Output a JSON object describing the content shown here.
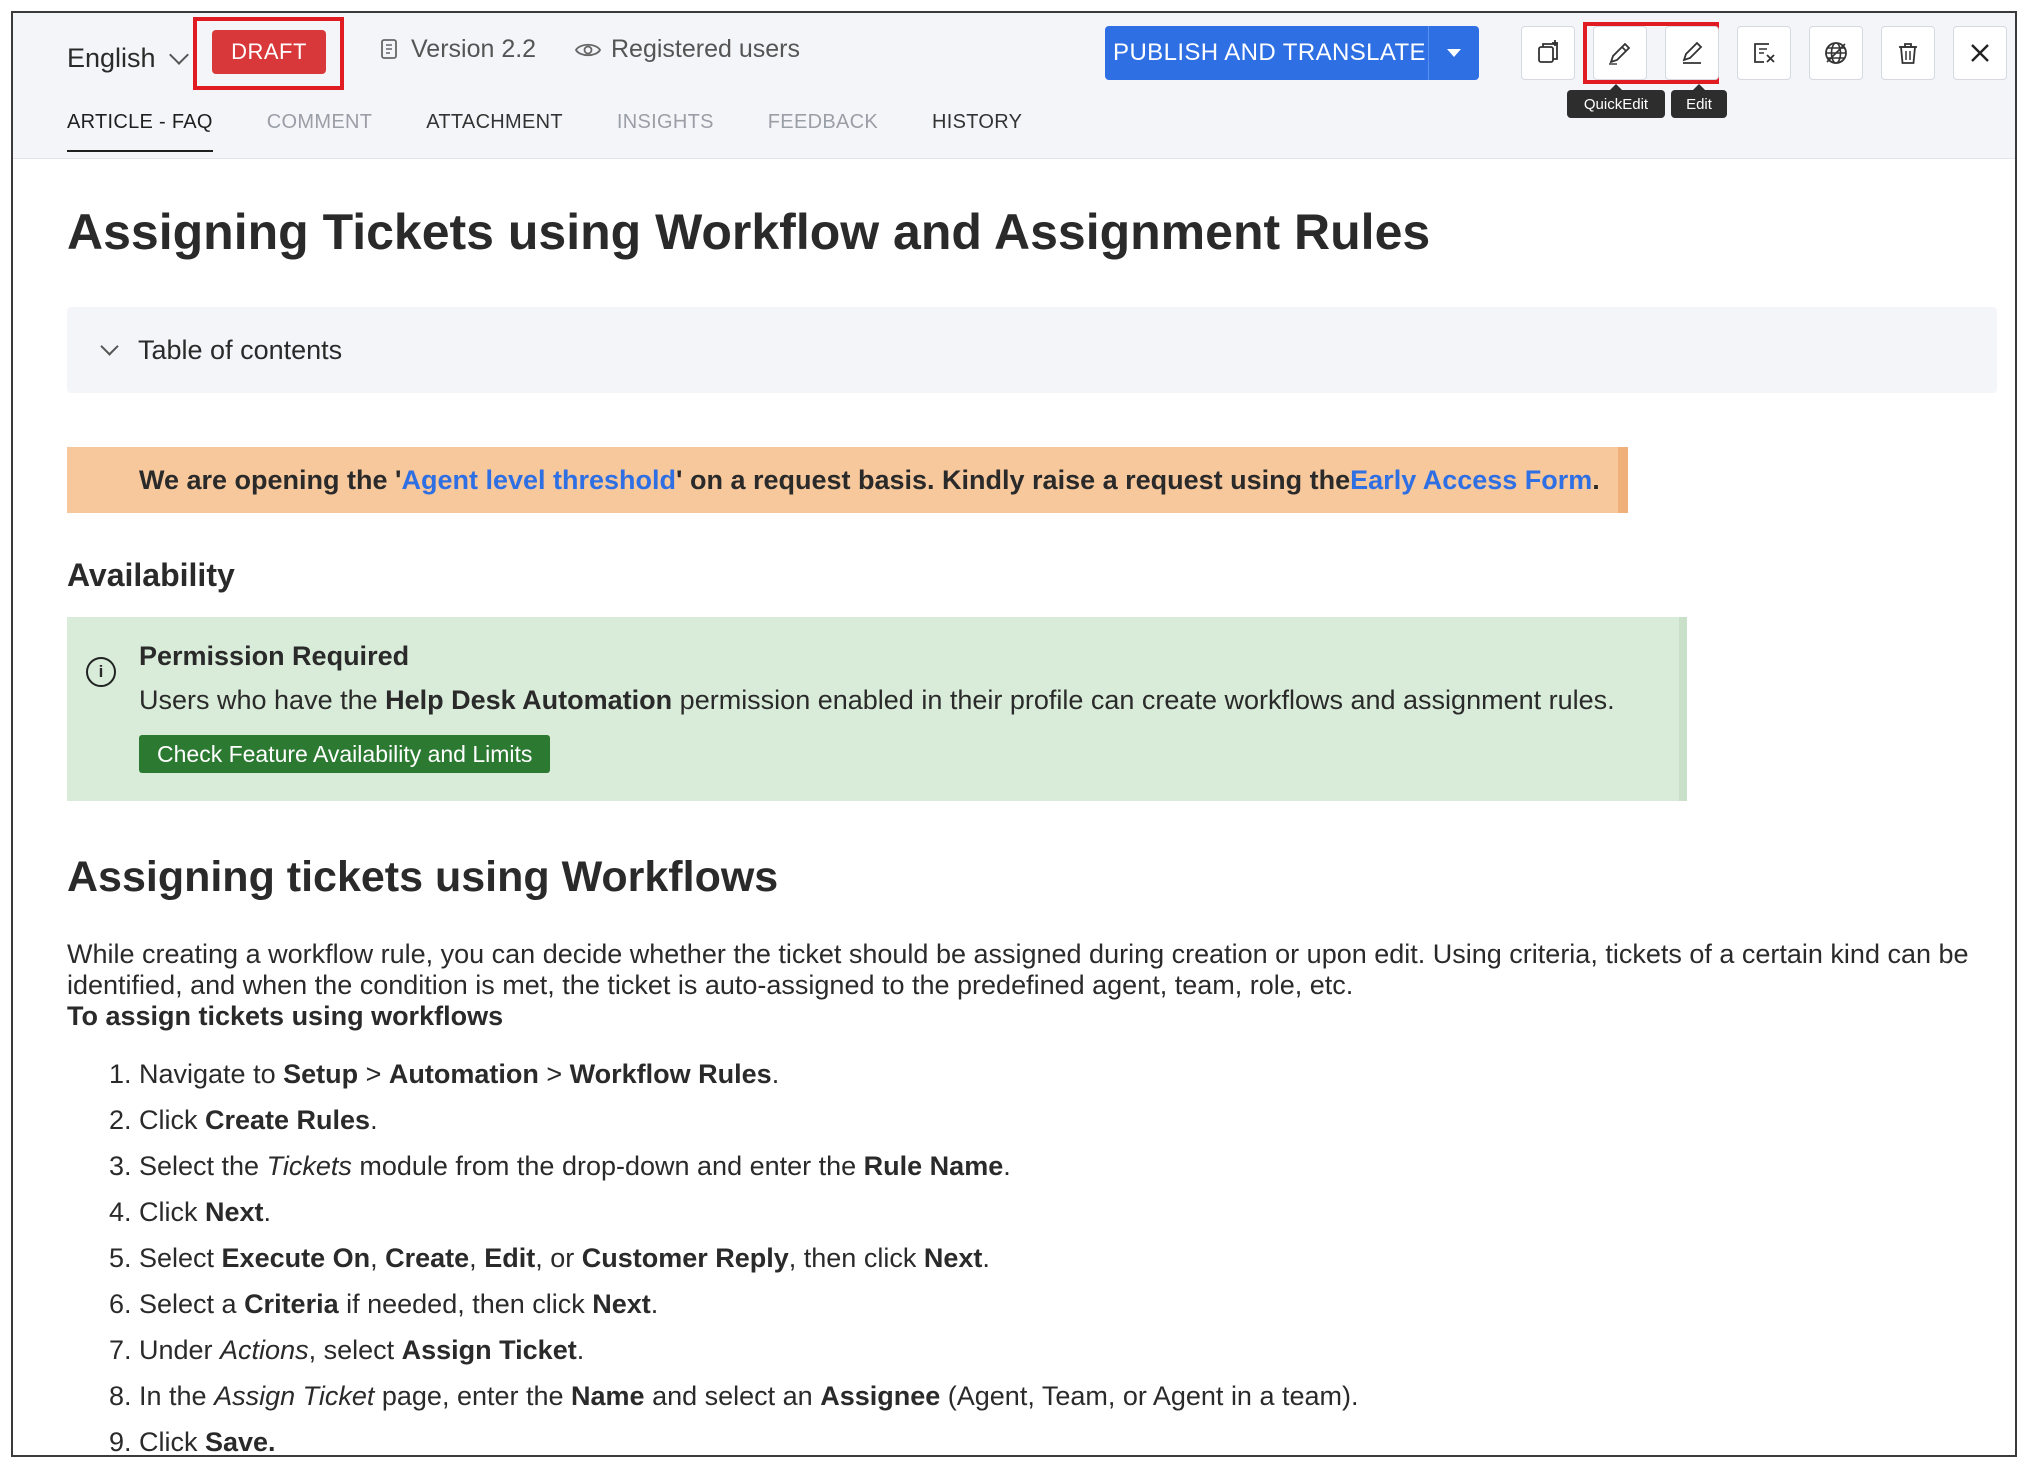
{
  "header": {
    "language": "English",
    "status_badge": "DRAFT",
    "version": "Version 2.2",
    "visibility": "Registered users",
    "publish_label": "PUBLISH AND TRANSLATE",
    "tooltips": {
      "quick_edit": "QuickEdit",
      "edit": "Edit"
    },
    "icons": [
      "copy-add-icon",
      "pencil-icon",
      "edit-pencil-icon",
      "unpublish-icon",
      "translate-globe-icon",
      "trash-icon",
      "close-icon"
    ]
  },
  "tabs": [
    {
      "label": "ARTICLE - FAQ",
      "state": "active"
    },
    {
      "label": "COMMENT",
      "state": "disabled"
    },
    {
      "label": "ATTACHMENT",
      "state": "normal"
    },
    {
      "label": "INSIGHTS",
      "state": "disabled"
    },
    {
      "label": "FEEDBACK",
      "state": "disabled"
    },
    {
      "label": "HISTORY",
      "state": "normal"
    }
  ],
  "article": {
    "title": "Assigning Tickets using Workflow and Assignment Rules",
    "toc_label": "Table of contents",
    "notice": {
      "pre": "We are opening the '",
      "link1": "Agent level threshold",
      "mid": "' on a request basis. Kindly raise a request using the ",
      "link2": "Early Access Form",
      "post": "."
    },
    "availability_heading": "Availability",
    "permission": {
      "title": "Permission Required",
      "pre": "Users who have the ",
      "bold": "Help Desk Automation",
      "post": " permission enabled in their profile can create workflows and assignment rules.",
      "button": "Check Feature Availability and Limits"
    },
    "section_heading": "Assigning tickets using Workflows",
    "paragraph": "While creating a workflow rule, you can decide whether the ticket should be assigned during creation or upon edit. Using criteria, tickets of a certain kind can be identified, and when the condition is met, the ticket is auto-assigned to the predefined agent, team, role, etc.",
    "procedure_heading": "To assign tickets using workflows",
    "steps": [
      [
        {
          "t": "Navigate to "
        },
        {
          "t": "Setup",
          "b": true
        },
        {
          "t": " > "
        },
        {
          "t": "Automation",
          "b": true
        },
        {
          "t": " > "
        },
        {
          "t": "Workflow Rules",
          "b": true
        },
        {
          "t": "."
        }
      ],
      [
        {
          "t": "Click "
        },
        {
          "t": "Create Rules",
          "b": true
        },
        {
          "t": "."
        }
      ],
      [
        {
          "t": "Select the "
        },
        {
          "t": "Tickets",
          "i": true
        },
        {
          "t": " module from the drop-down and enter the "
        },
        {
          "t": "Rule Name",
          "b": true
        },
        {
          "t": "."
        }
      ],
      [
        {
          "t": "Click "
        },
        {
          "t": "Next",
          "b": true
        },
        {
          "t": "."
        }
      ],
      [
        {
          "t": "Select "
        },
        {
          "t": "Execute On",
          "b": true
        },
        {
          "t": ", "
        },
        {
          "t": "Create",
          "b": true
        },
        {
          "t": ", "
        },
        {
          "t": "Edit",
          "b": true
        },
        {
          "t": ", or "
        },
        {
          "t": "Customer Reply",
          "b": true
        },
        {
          "t": ", then click "
        },
        {
          "t": "Next",
          "b": true
        },
        {
          "t": "."
        }
      ],
      [
        {
          "t": "Select a "
        },
        {
          "t": "Criteria",
          "b": true
        },
        {
          "t": " if needed, then click "
        },
        {
          "t": "Next",
          "b": true
        },
        {
          "t": "."
        }
      ],
      [
        {
          "t": "Under "
        },
        {
          "t": "Actions",
          "i": true
        },
        {
          "t": ", select "
        },
        {
          "t": "Assign Ticket",
          "b": true
        },
        {
          "t": "."
        }
      ],
      [
        {
          "t": "In the "
        },
        {
          "t": "Assign Ticket",
          "i": true
        },
        {
          "t": " page, enter the "
        },
        {
          "t": "Name",
          "b": true
        },
        {
          "t": " and select an "
        },
        {
          "t": "Assignee",
          "b": true
        },
        {
          "t": " (Agent, Team, or Agent in a team)."
        }
      ],
      [
        {
          "t": "Click "
        },
        {
          "t": "Save.",
          "b": true
        }
      ]
    ]
  },
  "colors": {
    "draft": "#d9383a",
    "publish": "#2f6fe4",
    "highlight_box": "#e11b22",
    "notice_bg": "#f7c89c",
    "permission_bg": "#d9ecd9",
    "permission_button": "#2c7a32"
  }
}
